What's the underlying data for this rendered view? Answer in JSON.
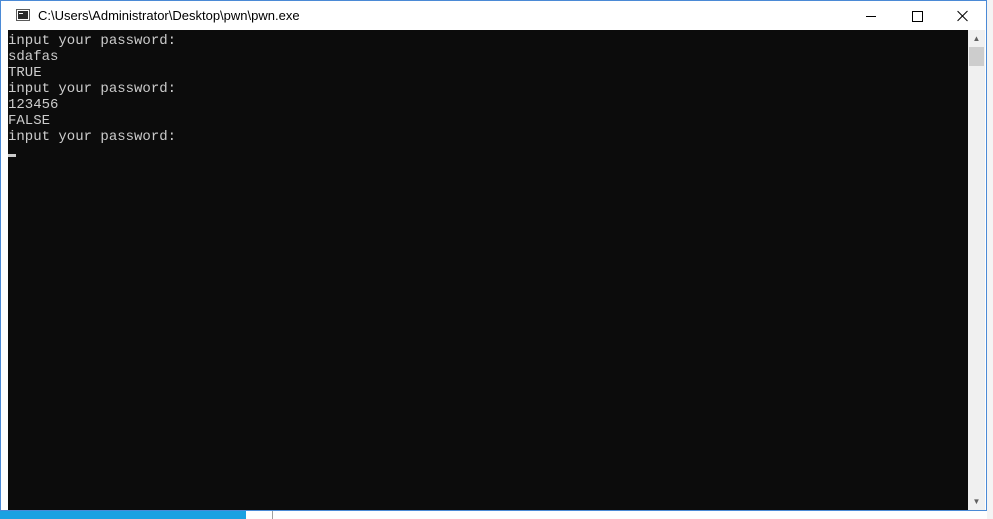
{
  "window": {
    "title": "C:\\Users\\Administrator\\Desktop\\pwn\\pwn.exe",
    "icon": "console-app-icon",
    "controls": {
      "minimize_icon": "minimize-icon",
      "maximize_icon": "maximize-icon",
      "close_icon": "close-icon"
    }
  },
  "console": {
    "background": "#0c0c0c",
    "foreground": "#cccccc",
    "lines": [
      "input your password:",
      "sdafas",
      "TRUE",
      "input your password:",
      "123456",
      "FALSE",
      "input your password:"
    ]
  },
  "scrollbar": {
    "up_arrow": "▲",
    "down_arrow": "▼"
  },
  "colors": {
    "desktop_accent": "#1ba1e2",
    "window_border": "#4b8ad6"
  }
}
